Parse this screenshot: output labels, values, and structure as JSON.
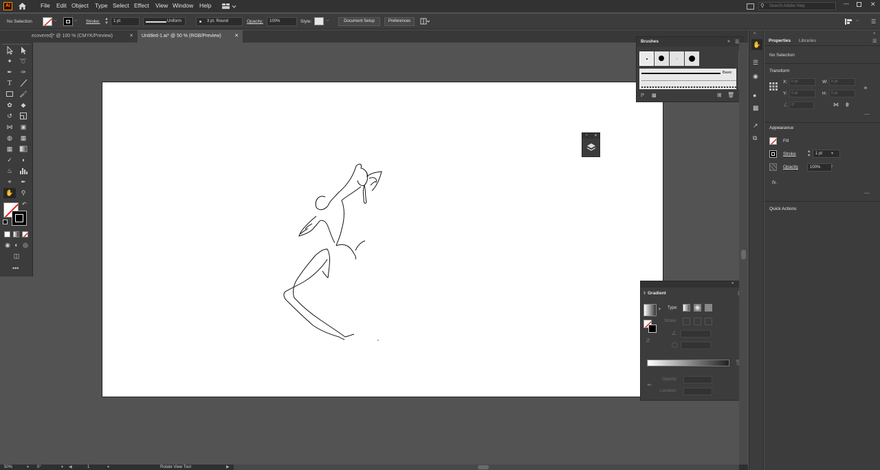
{
  "menu": {
    "app_logo": "Ai",
    "items": [
      "File",
      "Edit",
      "Object",
      "Type",
      "Select",
      "Effect",
      "View",
      "Window",
      "Help"
    ],
    "search_placeholder": "Search Adobe Help"
  },
  "control_bar": {
    "selection": "No Selection",
    "stroke_label": "Stroke:",
    "stroke_weight": "1 pt",
    "profile": "Uniform",
    "brush": "3 pt. Round",
    "opacity_label": "Opacity:",
    "opacity_value": "100%",
    "style_label": "Style:",
    "document_setup": "Document Setup",
    "preferences": "Preferences"
  },
  "tabs": [
    {
      "label": "ecovered]* @ 100 % (CMYK/Preview)",
      "active": false
    },
    {
      "label": "Untitled-1.ai* @ 50 % (RGB/Preview)",
      "active": true
    }
  ],
  "brushes_panel": {
    "title": "Brushes",
    "basic_label": "Basic"
  },
  "gradient_panel": {
    "title": "Gradient",
    "type_label": "Type:",
    "stroke_label": "Stroke:",
    "opacity_label": "Opacity:",
    "location_label": "Location:"
  },
  "properties": {
    "tab_properties": "Properties",
    "tab_libraries": "Libraries",
    "selection": "No Selection",
    "transform_head": "Transform",
    "x_label": "X:",
    "y_label": "Y:",
    "w_label": "W:",
    "h_label": "H:",
    "x_value": "0 pt",
    "y_value": "0 pt",
    "w_value": "0 pt",
    "h_value": "0 pt",
    "angle_value": "0°",
    "appearance_head": "Appearance",
    "fill_label": "Fill",
    "stroke_label": "Stroke",
    "stroke_value": "1 pt",
    "opacity_label": "Opacity",
    "opacity_value": "100%",
    "fx_label": "fx.",
    "quick_actions_head": "Quick Actions"
  },
  "status_bar": {
    "zoom": "50%",
    "rotation": "0°",
    "artboard_num": "1",
    "tool_name": "Rotate View Tool"
  },
  "colors": {
    "app_bg": "#535353",
    "panel_bg": "#3c3c3c",
    "menu_bg": "#323232",
    "logo_bg": "#330000",
    "logo_fg": "#ff9a00",
    "artboard": "#ffffff",
    "fill_none_red": "#e0201b"
  }
}
